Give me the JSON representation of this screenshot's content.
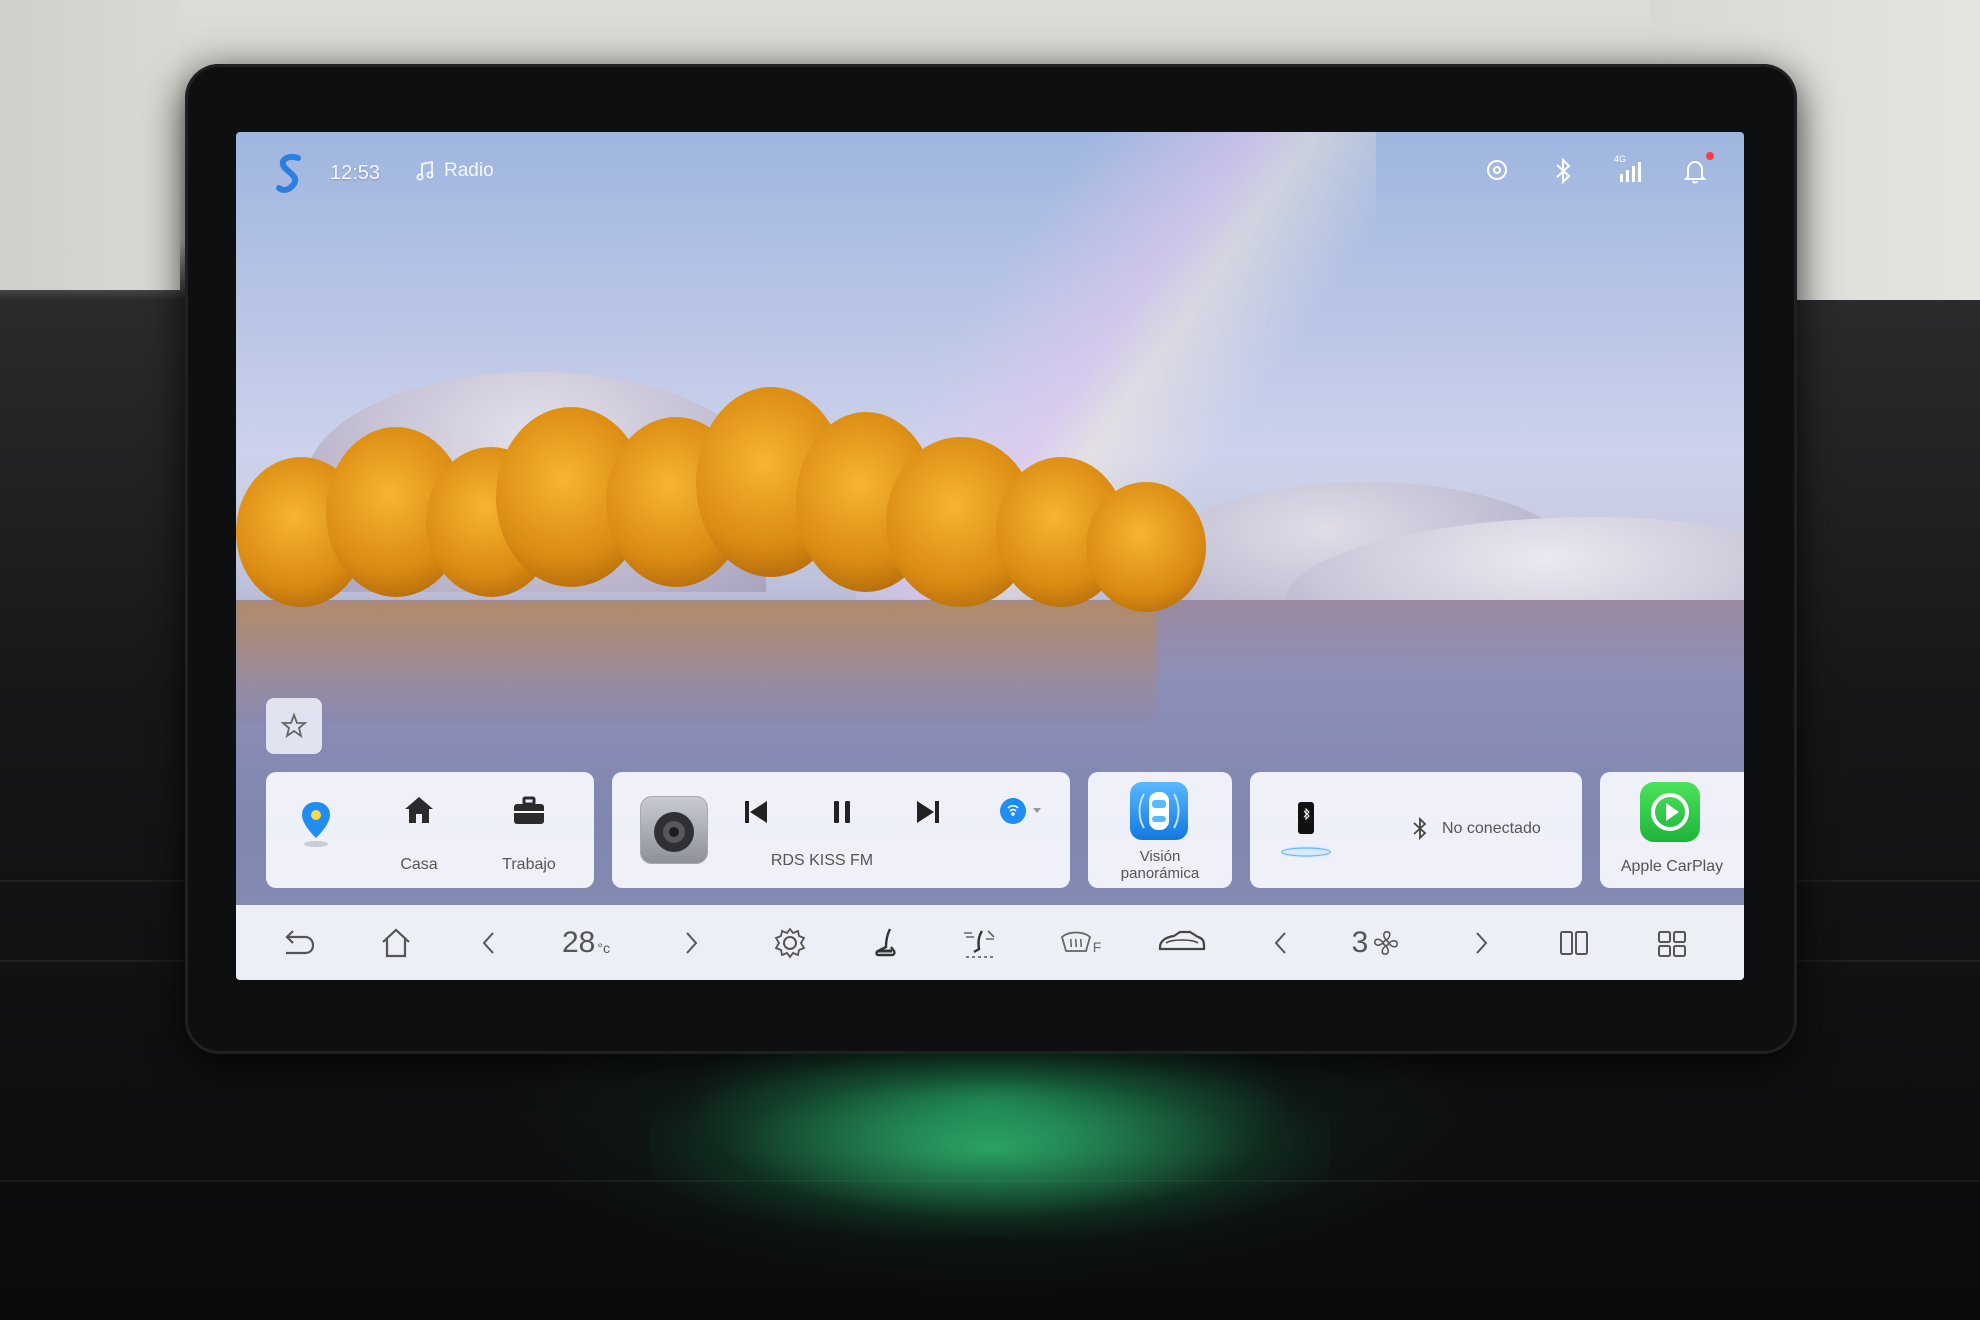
{
  "status_bar": {
    "time": "12:53",
    "source_label": "Radio",
    "icons": [
      "location-icon",
      "bluetooth-icon",
      "signal-4g-icon",
      "bell-icon"
    ],
    "network_label": "4G"
  },
  "nav_card": {
    "items": [
      {
        "name": "map-pin-icon",
        "label": ""
      },
      {
        "name": "home-icon",
        "label": "Casa"
      },
      {
        "name": "briefcase-icon",
        "label": "Trabajo"
      }
    ]
  },
  "media_card": {
    "station": "RDS KISS FM",
    "controls": [
      "previous-icon",
      "pause-icon",
      "next-icon",
      "source-selector-icon"
    ]
  },
  "panoramic_card": {
    "label_line1": "Visión",
    "label_line2": "panorámica"
  },
  "phone_card": {
    "status": "No conectado"
  },
  "carplay_card": {
    "label": "Apple CarPlay"
  },
  "dock": {
    "temperature": "28",
    "temperature_unit": "°c",
    "fan_speed": "3",
    "defrost_label": "F"
  },
  "colors": {
    "accent_blue": "#1f8ef0",
    "carplay_green": "#2fc944",
    "card_bg": "#f3f5fa",
    "notification_red": "#ff3b3b"
  }
}
